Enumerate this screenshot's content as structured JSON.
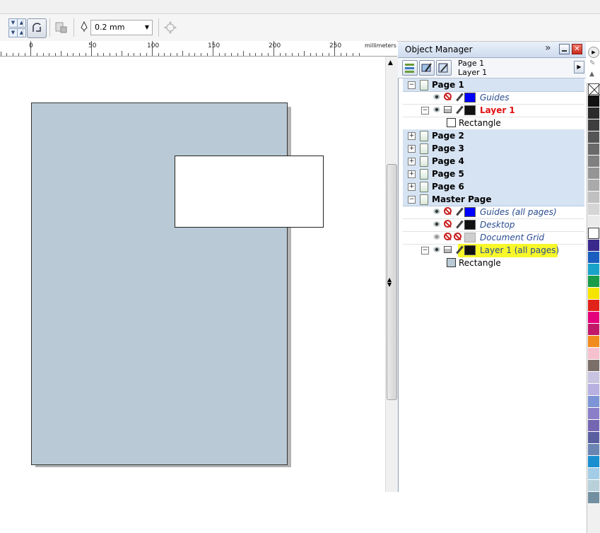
{
  "toolbar": {
    "outline_width": "0.2 mm"
  },
  "ruler": {
    "labels": [
      "0",
      "50",
      "100",
      "150",
      "200",
      "250"
    ],
    "unit": "millimeters"
  },
  "docker": {
    "title": "Object Manager",
    "current_page": "Page 1",
    "current_layer": "Layer 1"
  },
  "tree": {
    "page1": "Page 1",
    "page1_guides": "Guides",
    "page1_layer1": "Layer 1",
    "page1_rect": "Rectangle",
    "page2": "Page 2",
    "page3": "Page 3",
    "page4": "Page 4",
    "page5": "Page 5",
    "page6": "Page 6",
    "master": "Master Page",
    "master_guides": "Guides (all pages)",
    "master_desktop": "Desktop",
    "master_grid": "Document Grid",
    "master_layer1": "Layer 1 (all pages)",
    "master_rect": "Rectangle"
  },
  "colors": {
    "layer1_red": "#e01010",
    "guides_blue": "#0000ff",
    "layer_black": "#111111",
    "grid_gray": "#cfcfcf",
    "page_fill": "#b9cad6",
    "highlight": "#f7f72a"
  },
  "palette": [
    "#ffffff",
    "#111111",
    "#2b2b2b",
    "#3f3f3f",
    "#555555",
    "#6a6a6a",
    "#808080",
    "#959595",
    "#aaaaaa",
    "#c0c0c0",
    "#d5d5d5",
    "#eaeaea",
    "#ffffff",
    "#3a2a8c",
    "#1a5fbf",
    "#1aa3c8",
    "#1a9c49",
    "#f5e400",
    "#e2231a",
    "#e4007c",
    "#c2186a",
    "#f08c1e",
    "#f7c0cf",
    "#7c6f6a",
    "#c8c3e0",
    "#b8b0e0",
    "#7d94d6",
    "#8c7fc9",
    "#7566b2",
    "#5a5fa0",
    "#6b86b3",
    "#1a8fd0",
    "#a3cde6",
    "#b8d0da",
    "#7390a0"
  ]
}
